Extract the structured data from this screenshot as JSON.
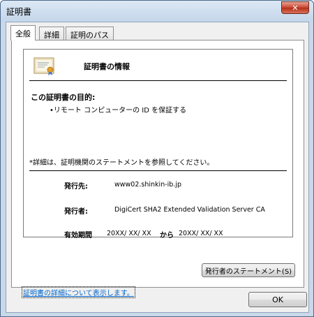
{
  "window": {
    "title": "証明書",
    "close_glyph": "✕"
  },
  "tabs": [
    {
      "label": "全般"
    },
    {
      "label": "詳細"
    },
    {
      "label": "証明のパス"
    }
  ],
  "general": {
    "heading": "証明書の情報",
    "purpose_title": "この証明書の目的:",
    "purpose_item": "•リモート コンピューターの ID を保証する",
    "footnote": "*詳細は、証明機関のステートメントを参照してください。",
    "issued_to_label": "発行先:",
    "issued_to_value": "www02.shinkin-ib.jp",
    "issued_by_label": "発行者:",
    "issued_by_value": "DigiCert SHA2 Extended Validation Server CA",
    "validity_label": "有効期間",
    "valid_from": "20XX/ XX/ XX",
    "from_to_word": "から",
    "valid_to": "20XX/ XX/ XX"
  },
  "buttons": {
    "issuer_statement": "発行者のステートメント(S)",
    "ok": "OK"
  },
  "links": {
    "details": "証明書の詳細について表示します。"
  },
  "colors": {
    "link": "#0066cc",
    "close_button": "#c8452f"
  }
}
